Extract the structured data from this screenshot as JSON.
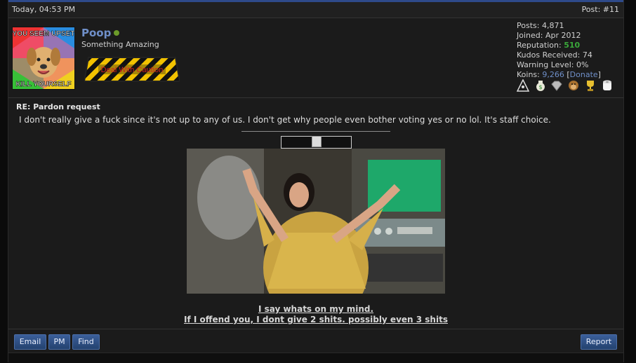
{
  "header": {
    "date": "Today, 04:53 PM",
    "post_number": "Post: #11"
  },
  "user": {
    "name": "Poop",
    "title": "Something Amazing",
    "avatar_top_text": "YOU SEEM UPSET",
    "avatar_bottom_text": "KILL YOURSELF",
    "rank_text": "Deal With Caution",
    "stats": {
      "posts_label": "Posts:",
      "posts": "4,871",
      "joined_label": "Joined:",
      "joined": "Apr 2012",
      "reputation_label": "Reputation:",
      "reputation": "510",
      "kudos_label": "Kudos Received:",
      "kudos": "74",
      "warning_label": "Warning Level:",
      "warning": "0%",
      "koins_label": "Koins:",
      "koins": "9,266",
      "donate": "Donate"
    },
    "awards": [
      "illuminati-icon",
      "money-bag-icon",
      "diamond-icon",
      "monkey-icon",
      "trophy-icon",
      "toilet-paper-icon"
    ]
  },
  "post": {
    "title": "RE: Pardon request",
    "text": "I don't really give a fuck since it's not up to any of us. I don't get why people even bother voting yes or no lol. It's staff choice.",
    "signature_line1": "I say whats on my mind.",
    "signature_line2": "If I offend you, I dont give 2 shits. possibly even 3 shits"
  },
  "footer": {
    "email": "Email",
    "pm": "PM",
    "find": "Find",
    "report": "Report"
  },
  "colors": {
    "accent": "#2e4a8a",
    "username": "#6f8fc8",
    "reputation": "#3aa83a",
    "button": "#2f4f84"
  }
}
